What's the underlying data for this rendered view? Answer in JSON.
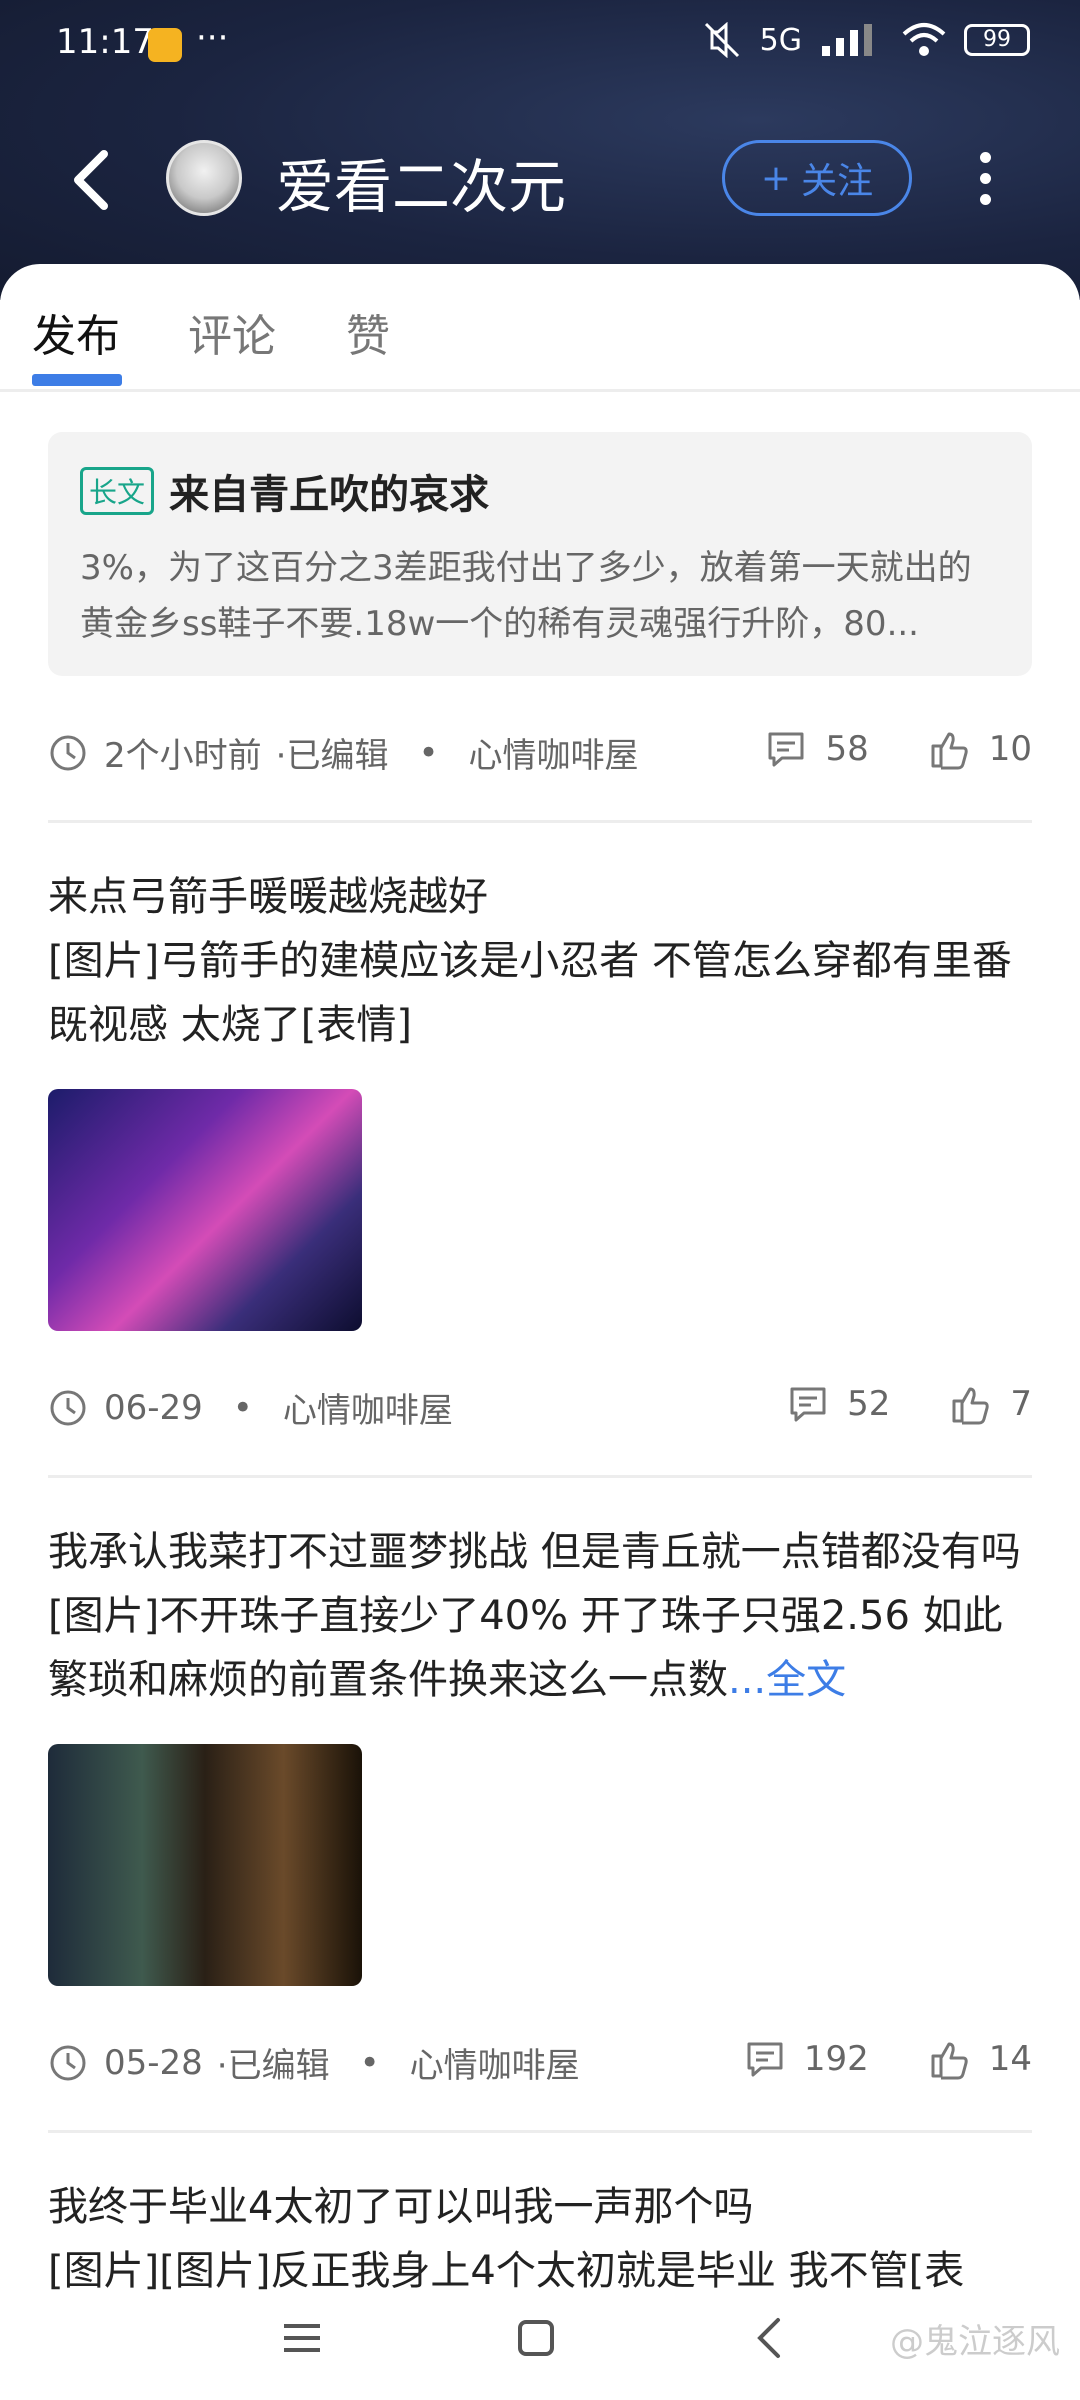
{
  "status_bar": {
    "time": "11:17",
    "dots": "···",
    "network": "5G",
    "battery": "99"
  },
  "header": {
    "title": "爱看二次元",
    "follow_label": "关注",
    "follow_plus": "+"
  },
  "tabs": [
    {
      "label": "发布",
      "active": true
    },
    {
      "label": "评论",
      "active": false
    },
    {
      "label": "赞",
      "active": false
    }
  ],
  "card1": {
    "badge": "长文",
    "title": "来自青丘吹的哀求",
    "excerpt": "3%，为了这百分之3差距我付出了多少，放着第一天就出的黄金乡ss鞋子不要.18w一个的稀有灵魂强行升阶，80...",
    "time": "2个小时前",
    "edited": "·已编辑",
    "dot": "•",
    "forum": "心情咖啡屋",
    "comments": "58",
    "likes": "10"
  },
  "post1": {
    "title": "来点弓箭手暖暖越烧越好",
    "body": "[图片]弓箭手的建模应该是小忍者 不管怎么穿都有里番既视感 太烧了[表情]",
    "time": "06-29",
    "dot": "•",
    "forum": "心情咖啡屋",
    "comments": "52",
    "likes": "7"
  },
  "post2": {
    "body": "我承认我菜打不过噩梦挑战 但是青丘就一点错都没有吗 [图片]不开珠子直接少了40% 开了珠子只强2.56 如此繁琐和麻烦的前置条件换来这么一点数",
    "more": "...全文",
    "time": "05-28",
    "edited": "·已编辑",
    "dot": "•",
    "forum": "心情咖啡屋",
    "comments": "192",
    "likes": "14"
  },
  "post3": {
    "title": "我终于毕业4太初了可以叫我一声那个吗",
    "body": "[图片][图片]反正我身上4个太初就是毕业 我不管[表"
  },
  "watermark": "@鬼泣逐风",
  "colors": {
    "accent": "#3d7de6",
    "badge": "#18a58a",
    "header": "#1b2440"
  }
}
